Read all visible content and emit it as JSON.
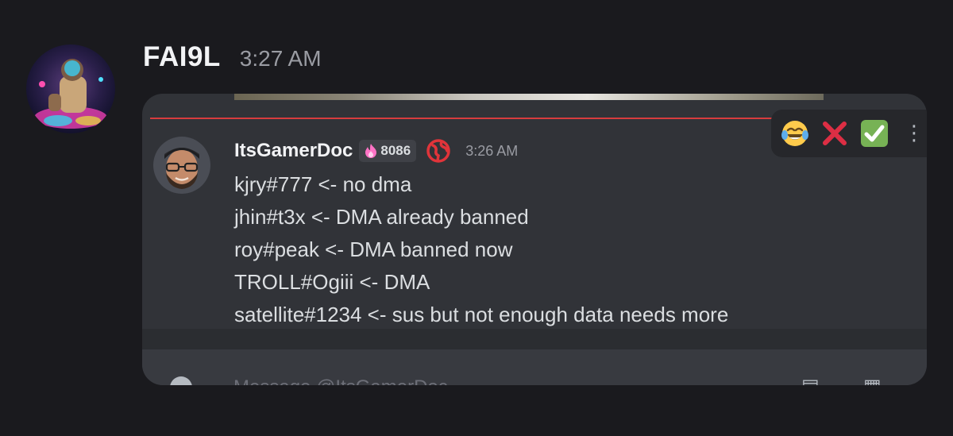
{
  "outer_message": {
    "author": "FAI9L",
    "timestamp": "3:27 AM",
    "avatar_icon": "avatar-gamer-art-icon"
  },
  "embedded_screenshot": {
    "reactions": [
      {
        "icon": "laughing-tears-emoji-icon",
        "glyph": "😂"
      },
      {
        "icon": "red-x-emoji-icon",
        "glyph": "❌"
      },
      {
        "icon": "green-check-emoji-icon",
        "glyph": "✅"
      }
    ],
    "more_actions_glyph": "⋮",
    "message": {
      "author": "ItsGamerDoc",
      "tag": "8086",
      "tag_icon": "flame-tag-icon",
      "timestamp": "3:26 AM",
      "lines": [
        "kjry#777 <- no dma",
        "jhin#t3x <- DMA already banned",
        "roy#peak <- DMA banned now",
        "TROLL#Ogiii <- DMA",
        "satellite#1234 <- sus but not enough data needs more"
      ]
    },
    "composer": {
      "placeholder": "Message @ItsGamerDoc"
    }
  },
  "colors": {
    "background": "#1a1a1e",
    "card": "#313338",
    "accent_red": "#d83c3e"
  }
}
